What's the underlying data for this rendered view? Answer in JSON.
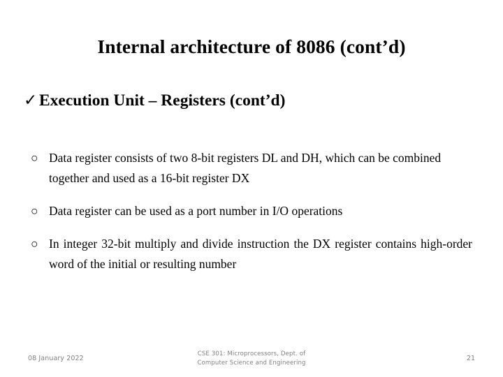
{
  "slide": {
    "title": "Internal architecture of 8086 (cont’d)",
    "subtitle": {
      "marker": "check-mark-bullet",
      "marker_glyph": "✓",
      "text": "Execution Unit – Registers (cont’d)"
    },
    "bullets": [
      {
        "marker_glyph": "○",
        "text": "Data register consists of two 8-bit registers DL and DH, which can be combined together and used as a 16-bit register DX",
        "justified": false
      },
      {
        "marker_glyph": "○",
        "text": "Data register can be used as a port number in I/O operations",
        "justified": false
      },
      {
        "marker_glyph": "○",
        "text": "In integer 32-bit multiply and divide instruction the DX register contains high-order word of the initial or resulting number",
        "justified": true
      }
    ],
    "footer": {
      "date": "08 January 2022",
      "course_line1": "CSE 301: Microprocessors, Dept. of",
      "course_line2": "Computer Science and Engineering",
      "page_number": "21"
    },
    "colors": {
      "background": "#ffffff",
      "text": "#000000",
      "footer_text": "#808080"
    }
  }
}
